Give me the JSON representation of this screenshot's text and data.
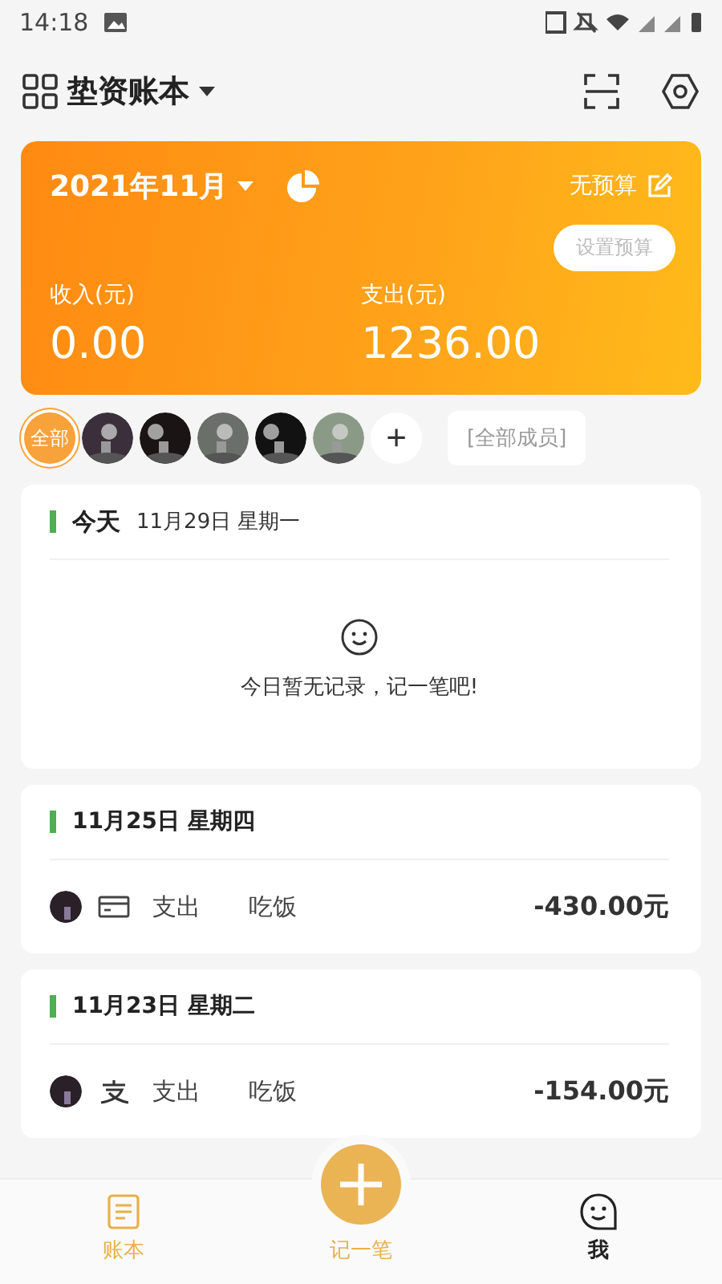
{
  "status_bar": {
    "time": "14:18"
  },
  "header": {
    "title": "垫资账本"
  },
  "summary": {
    "month": "2021年11月",
    "budget_label": "无预算",
    "budget_tooltip": "设置预算",
    "income_label": "收入(元)",
    "income": "0.00",
    "expense_label": "支出(元)",
    "expense": "1236.00"
  },
  "members": [
    {
      "kind": "all",
      "label": "全部",
      "selected": true
    },
    {
      "kind": "avatar",
      "selected": false,
      "color": "#3a2f3a"
    },
    {
      "kind": "avatar",
      "selected": false,
      "color": "#1a1414"
    },
    {
      "kind": "avatar",
      "selected": false,
      "color": "#6b6f6a"
    },
    {
      "kind": "avatar",
      "selected": false,
      "color": "#121212"
    },
    {
      "kind": "avatar",
      "selected": false,
      "color": "#8a9a86"
    },
    {
      "kind": "add",
      "label": "+"
    }
  ],
  "member_filter": "[全部成员]",
  "days": [
    {
      "label": "今天",
      "date": "11月29日 星期一",
      "empty_text": "今日暂无记录，记一笔吧!"
    },
    {
      "date": "11月25日 星期四",
      "records": [
        {
          "kind": "card",
          "type": "支出",
          "category": "吃饭",
          "amount": "-430.00元"
        }
      ]
    },
    {
      "date": "11月23日 星期二",
      "records": [
        {
          "kind": "alipay",
          "type": "支出",
          "category": "吃饭",
          "amount": "-154.00元"
        }
      ]
    }
  ],
  "nav": [
    {
      "kind": "ledger",
      "label": "账本",
      "selected": true
    },
    {
      "kind": "add",
      "label": "记一笔"
    },
    {
      "kind": "me",
      "label": "我",
      "selected": false
    }
  ]
}
